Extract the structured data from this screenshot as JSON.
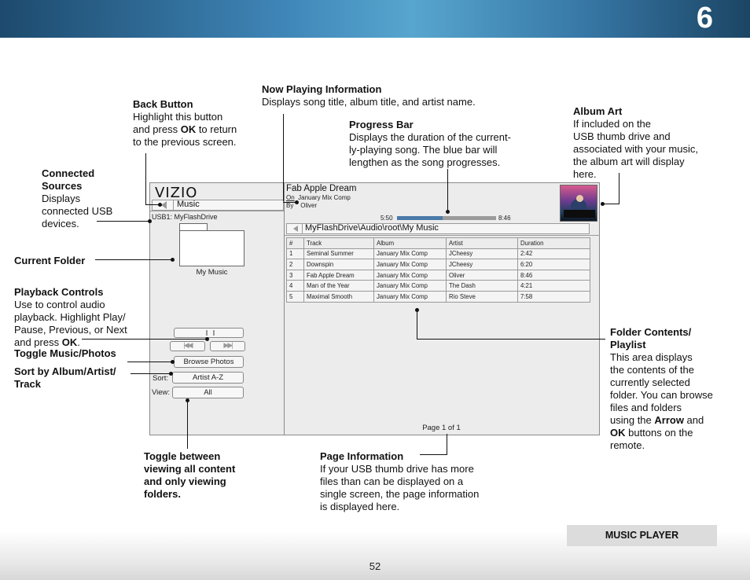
{
  "header": {
    "chapter": "6"
  },
  "footer": {
    "page_number": "52",
    "section": "MUSIC PLAYER"
  },
  "callouts": {
    "back_button": {
      "title": "Back Button",
      "line1": "Highlight this button",
      "line2a": "and press ",
      "line2b": "OK",
      "line2c": " to return",
      "line3": "to the previous screen."
    },
    "now_playing": {
      "title": "Now Playing Information",
      "body": "Displays song title, album title, and artist name."
    },
    "progress_bar": {
      "title": "Progress Bar",
      "line1": "Displays the duration of the current-",
      "line2": "ly-playing song. The blue bar will",
      "line3": "lengthen as the song progresses."
    },
    "album_art": {
      "title": "Album Art",
      "line1": "If included on the",
      "line2": "USB thumb drive and",
      "line3": "associated with your music,",
      "line4": "the album art will display",
      "line5": "here."
    },
    "connected_sources": {
      "title1": "Connected",
      "title2": "Sources",
      "line1": "Displays",
      "line2": "connected USB",
      "line3": "devices."
    },
    "current_folder": {
      "title": "Current Folder"
    },
    "playback_controls": {
      "title": "Playback Controls",
      "line1": "Use to control audio",
      "line2": "playback. Highlight Play/",
      "line3": "Pause, Previous, or Next",
      "line4a": "and press ",
      "line4b": "OK",
      "line4c": "."
    },
    "toggle_music_photos": {
      "title": "Toggle Music/Photos"
    },
    "sort": {
      "title1": "Sort by Album/Artist/",
      "title2": "Track"
    },
    "folder_contents": {
      "title1": "Folder Contents/",
      "title2": "Playlist",
      "line1": "This area displays",
      "line2": "the contents of the",
      "line3": "currently selected",
      "line4": "folder. You can browse",
      "line5": "files and folders",
      "line6a": "using the ",
      "line6b": "Arrow",
      "line6c": " and",
      "line7a": "OK",
      "line7b": " buttons on the",
      "line8": "remote."
    },
    "toggle_view": {
      "title1": "Toggle between",
      "title2": "viewing all content",
      "title3": "and only viewing",
      "title4": "folders."
    },
    "page_information": {
      "title": "Page Information",
      "line1": "If your USB thumb drive has more",
      "line2": "files than can be displayed on a",
      "line3": "single screen, the page information",
      "line4": "is displayed here."
    }
  },
  "screen": {
    "logo": "VIZIO",
    "back_label": "Music",
    "usb_source": "USB1: MyFlashDrive",
    "folder_label": "My Music",
    "browse_photos": "Browse Photos",
    "sort_label": "Sort:",
    "sort_value": "Artist A-Z",
    "view_label": "View:",
    "view_value": "All",
    "now_playing": {
      "title": "Fab Apple Dream",
      "on_label": "On",
      "album": "January Mix Comp",
      "by_label": "By",
      "artist": "Oliver"
    },
    "elapsed": "5:50",
    "total": "8:46",
    "progress": 0.46,
    "path": "MyFlashDrive\\Audio\\root\\My Music",
    "columns": [
      "#",
      "Track",
      "Album",
      "Artist",
      "Duration"
    ],
    "rows": [
      [
        "1",
        "Seminal Summer",
        "January Mix Comp",
        "JCheesy",
        "2:42"
      ],
      [
        "2",
        "Downspin",
        "January Mix Comp",
        "JCheesy",
        "6:20"
      ],
      [
        "3",
        "Fab Apple Dream",
        "January Mix Comp",
        "Oliver",
        "8:46"
      ],
      [
        "4",
        "Man of the Year",
        "January Mix Comp",
        "The Dash",
        "4:21"
      ],
      [
        "5",
        "Maximal Smooth",
        "January Mix Comp",
        "Rio Steve",
        "7:58"
      ]
    ],
    "page_info": "Page 1 of 1"
  },
  "icons": [
    "back-arrow-icon",
    "folder-icon",
    "play-pause-icon",
    "previous-icon",
    "next-icon",
    "album-art-image"
  ]
}
